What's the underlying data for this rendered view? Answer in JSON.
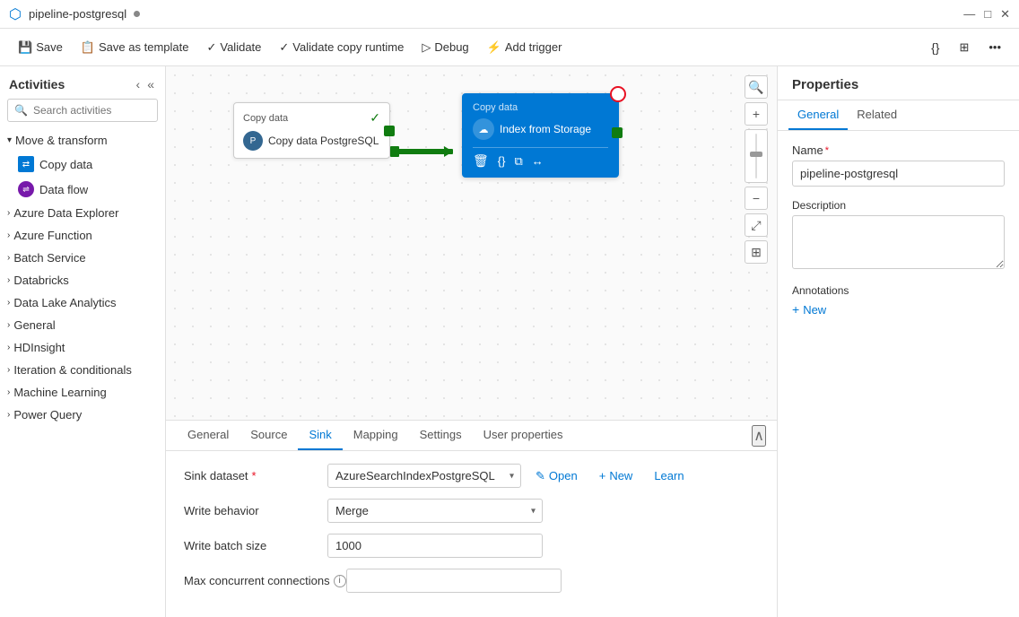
{
  "titlebar": {
    "icon": "⬡",
    "title": "pipeline-postgresql",
    "dot_visible": true,
    "minimize": "—",
    "maximize": "□",
    "close": "✕"
  },
  "toolbar": {
    "save_label": "Save",
    "save_as_template_label": "Save as template",
    "validate_label": "Validate",
    "validate_copy_runtime_label": "Validate copy runtime",
    "debug_label": "Debug",
    "add_trigger_label": "Add trigger"
  },
  "sidebar": {
    "title": "Activities",
    "search_placeholder": "Search activities",
    "categories": [
      {
        "id": "move-transform",
        "label": "Move & transform",
        "expanded": true
      },
      {
        "id": "azure-data-explorer",
        "label": "Azure Data Explorer",
        "expanded": false
      },
      {
        "id": "azure-function",
        "label": "Azure Function",
        "expanded": false
      },
      {
        "id": "batch-service",
        "label": "Batch Service",
        "expanded": false
      },
      {
        "id": "databricks",
        "label": "Databricks",
        "expanded": false
      },
      {
        "id": "data-lake-analytics",
        "label": "Data Lake Analytics",
        "expanded": false
      },
      {
        "id": "general",
        "label": "General",
        "expanded": false
      },
      {
        "id": "hdinsight",
        "label": "HDInsight",
        "expanded": false
      },
      {
        "id": "iteration-conditionals",
        "label": "Iteration & conditionals",
        "expanded": false
      },
      {
        "id": "machine-learning",
        "label": "Machine Learning",
        "expanded": false
      },
      {
        "id": "power-query",
        "label": "Power Query",
        "expanded": false
      }
    ],
    "move_transform_items": [
      {
        "id": "copy-data",
        "label": "Copy data",
        "icon_color": "#0078d4"
      },
      {
        "id": "data-flow",
        "label": "Data flow",
        "icon_color": "#7719aa"
      }
    ]
  },
  "canvas": {
    "node1": {
      "header": "Copy data",
      "title": "Copy data PostgreSQL",
      "success": true
    },
    "node2": {
      "header": "Copy data",
      "title": "Index from Storage"
    },
    "arrow_label": ""
  },
  "bottom_panel": {
    "tabs": [
      {
        "id": "general",
        "label": "General",
        "active": false
      },
      {
        "id": "source",
        "label": "Source",
        "active": false
      },
      {
        "id": "sink",
        "label": "Sink",
        "active": true
      },
      {
        "id": "mapping",
        "label": "Mapping",
        "active": false
      },
      {
        "id": "settings",
        "label": "Settings",
        "active": false
      },
      {
        "id": "user-properties",
        "label": "User properties",
        "active": false
      }
    ],
    "sink": {
      "dataset_label": "Sink dataset",
      "dataset_required": "*",
      "dataset_value": "AzureSearchIndexPostgreSQL",
      "open_btn": "Open",
      "new_btn": "New",
      "learn_btn": "Learn",
      "write_behavior_label": "Write behavior",
      "write_behavior_value": "Merge",
      "write_batch_size_label": "Write batch size",
      "write_batch_size_value": "1000",
      "max_concurrent_label": "Max concurrent connections",
      "max_concurrent_value": "",
      "max_concurrent_placeholder": ""
    }
  },
  "properties": {
    "title": "Properties",
    "tabs": [
      {
        "id": "general",
        "label": "General",
        "active": true
      },
      {
        "id": "related",
        "label": "Related",
        "active": false
      }
    ],
    "name_label": "Name",
    "name_required": "*",
    "name_value": "pipeline-postgresql",
    "description_label": "Description",
    "description_value": "",
    "annotations_label": "Annotations",
    "new_annotation_label": "New"
  }
}
